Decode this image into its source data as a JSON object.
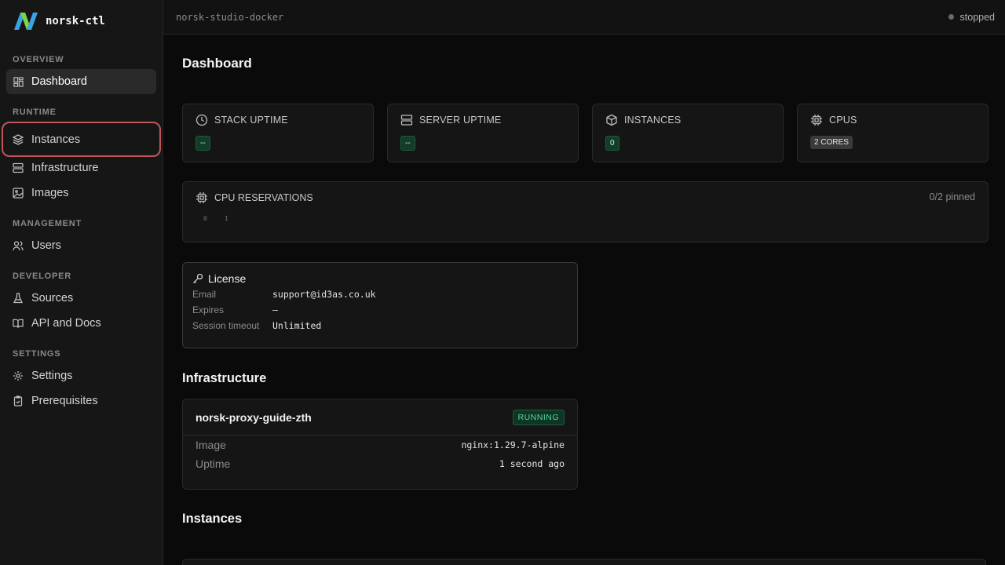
{
  "brand": {
    "name": "norsk-ctl"
  },
  "sidebar": {
    "sections": [
      {
        "label": "OVERVIEW",
        "items": [
          {
            "label": "Dashboard",
            "icon": "dashboard-icon"
          }
        ]
      },
      {
        "label": "RUNTIME",
        "items": [
          {
            "label": "Instances",
            "icon": "layers-icon"
          },
          {
            "label": "Infrastructure",
            "icon": "server-icon"
          },
          {
            "label": "Images",
            "icon": "image-icon"
          }
        ]
      },
      {
        "label": "MANAGEMENT",
        "items": [
          {
            "label": "Users",
            "icon": "users-icon"
          }
        ]
      },
      {
        "label": "DEVELOPER",
        "items": [
          {
            "label": "Sources",
            "icon": "flask-icon"
          },
          {
            "label": "API and Docs",
            "icon": "book-icon"
          }
        ]
      },
      {
        "label": "SETTINGS",
        "items": [
          {
            "label": "Settings",
            "icon": "gear-icon"
          },
          {
            "label": "Prerequisites",
            "icon": "clipboard-check-icon"
          }
        ]
      }
    ]
  },
  "topbar": {
    "project": "norsk-studio-docker",
    "status": "stopped"
  },
  "page": {
    "title": "Dashboard"
  },
  "stats": [
    {
      "label": "STACK UPTIME",
      "value": "--",
      "icon": "clock-icon"
    },
    {
      "label": "SERVER UPTIME",
      "value": "--",
      "icon": "server-icon"
    },
    {
      "label": "INSTANCES",
      "value": "0",
      "icon": "box-icon"
    },
    {
      "label": "CPUS",
      "value": "2 CORES",
      "icon": "cpu-icon"
    }
  ],
  "cpu_reservations": {
    "label": "CPU RESERVATIONS",
    "pinned": "0/2 pinned",
    "cores": [
      "0",
      "1"
    ]
  },
  "license": {
    "title": "License",
    "rows": [
      {
        "key": "Email",
        "value": "support@id3as.co.uk"
      },
      {
        "key": "Expires",
        "value": "—"
      },
      {
        "key": "Session timeout",
        "value": "Unlimited"
      }
    ]
  },
  "infrastructure": {
    "title": "Infrastructure",
    "card": {
      "name": "norsk-proxy-guide-zth",
      "status": "RUNNING",
      "rows": [
        {
          "key": "Image",
          "value": "nginx:1.29.7-alpine"
        },
        {
          "key": "Uptime",
          "value": "1 second ago"
        }
      ]
    }
  },
  "instances": {
    "title": "Instances"
  },
  "colors": {
    "accent_green": "#5ad69a",
    "highlight_outline": "#c0565b",
    "logo_green": "#7fd34a",
    "logo_blue": "#3aa3e3"
  }
}
